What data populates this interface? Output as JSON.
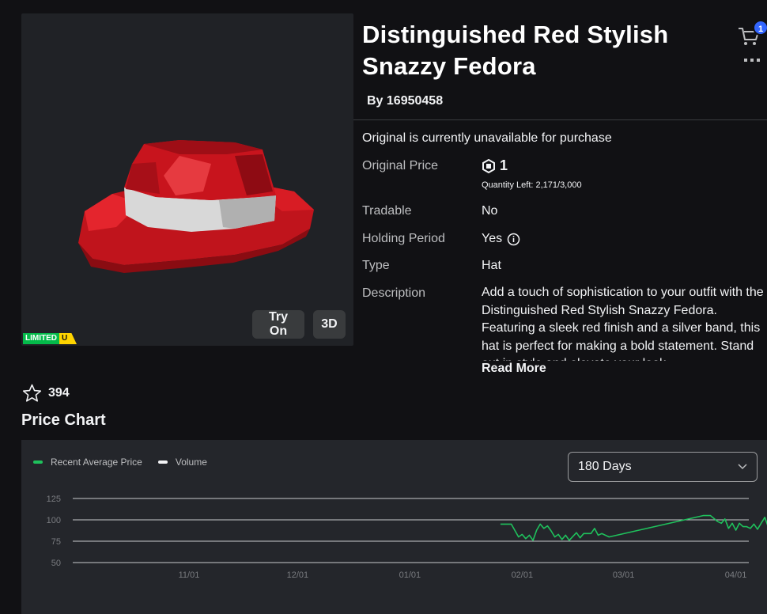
{
  "item": {
    "title_line1": "Distinguished Red Stylish",
    "title_line2": "Snazzy Fedora",
    "by_label": "By",
    "creator": "16950458"
  },
  "cart": {
    "badge_count": "1"
  },
  "thumbnail": {
    "try_on_label": "Try On",
    "view_3d_label": "3D",
    "limited_label": "LIMITED",
    "unique_label": "U"
  },
  "details": {
    "unavailable_notice": "Original is currently unavailable for purchase",
    "price_label": "Original Price",
    "price_value": "1",
    "quantity_left": "Quantity Left: 2,171/3,000",
    "tradable_label": "Tradable",
    "tradable_value": "No",
    "holding_label": "Holding Period",
    "holding_value": "Yes",
    "type_label": "Type",
    "type_value": "Hat",
    "description_label": "Description",
    "description": "Add a touch of sophistication to your outfit with the Distinguished Red Stylish Snazzy Fedora. Featuring a sleek red finish and a silver band, this hat is perfect for making a bold statement. Stand out in style and elevate your look.",
    "read_more_label": "Read More"
  },
  "favorites": {
    "count": "394"
  },
  "price_chart": {
    "heading": "Price Chart",
    "range_selected": "180 Days",
    "legend": [
      {
        "name": "Recent Average Price",
        "color": "#1fc15c"
      },
      {
        "name": "Volume",
        "color": "#f2f3f5"
      }
    ]
  },
  "chart_data": {
    "type": "line",
    "title": "",
    "xlabel": "",
    "ylabel": "",
    "y_ticks": [
      125,
      100,
      75,
      50
    ],
    "ylim": [
      50,
      125
    ],
    "x_ticks": [
      "11/01",
      "12/01",
      "01/01",
      "02/01",
      "03/01",
      "04/01"
    ],
    "grid": true,
    "legend_position": "top-left",
    "series": [
      {
        "name": "Recent Average Price",
        "color": "#1fc15c",
        "points": [
          [
            "01/26",
            95
          ],
          [
            "01/29",
            95
          ],
          [
            "01/31",
            80
          ],
          [
            "02/01",
            83
          ],
          [
            "02/02",
            78
          ],
          [
            "02/03",
            82
          ],
          [
            "02/04",
            76
          ],
          [
            "02/05",
            88
          ],
          [
            "02/06",
            95
          ],
          [
            "02/07",
            90
          ],
          [
            "02/08",
            93
          ],
          [
            "02/09",
            87
          ],
          [
            "02/10",
            80
          ],
          [
            "02/11",
            83
          ],
          [
            "02/12",
            77
          ],
          [
            "02/13",
            82
          ],
          [
            "02/14",
            76
          ],
          [
            "02/16",
            85
          ],
          [
            "02/17",
            79
          ],
          [
            "02/18",
            84
          ],
          [
            "02/20",
            84
          ],
          [
            "02/21",
            90
          ],
          [
            "02/22",
            82
          ],
          [
            "02/23",
            84
          ],
          [
            "02/25",
            80
          ],
          [
            "03/23",
            105
          ],
          [
            "03/25",
            105
          ],
          [
            "03/27",
            98
          ],
          [
            "03/28",
            96
          ],
          [
            "03/29",
            101
          ],
          [
            "03/30",
            90
          ],
          [
            "03/31",
            96
          ],
          [
            "04/01",
            88
          ],
          [
            "04/02",
            96
          ],
          [
            "04/03",
            92
          ],
          [
            "04/04",
            92
          ],
          [
            "04/05",
            90
          ],
          [
            "04/06",
            95
          ],
          [
            "04/07",
            89
          ],
          [
            "04/08",
            96
          ],
          [
            "04/09",
            103
          ],
          [
            "04/10",
            91
          ],
          [
            "04/11",
            94
          ],
          [
            "04/12",
            104
          ],
          [
            "04/13",
            105
          ],
          [
            "04/14",
            100
          ],
          [
            "04/15",
            89
          ]
        ]
      }
    ]
  }
}
